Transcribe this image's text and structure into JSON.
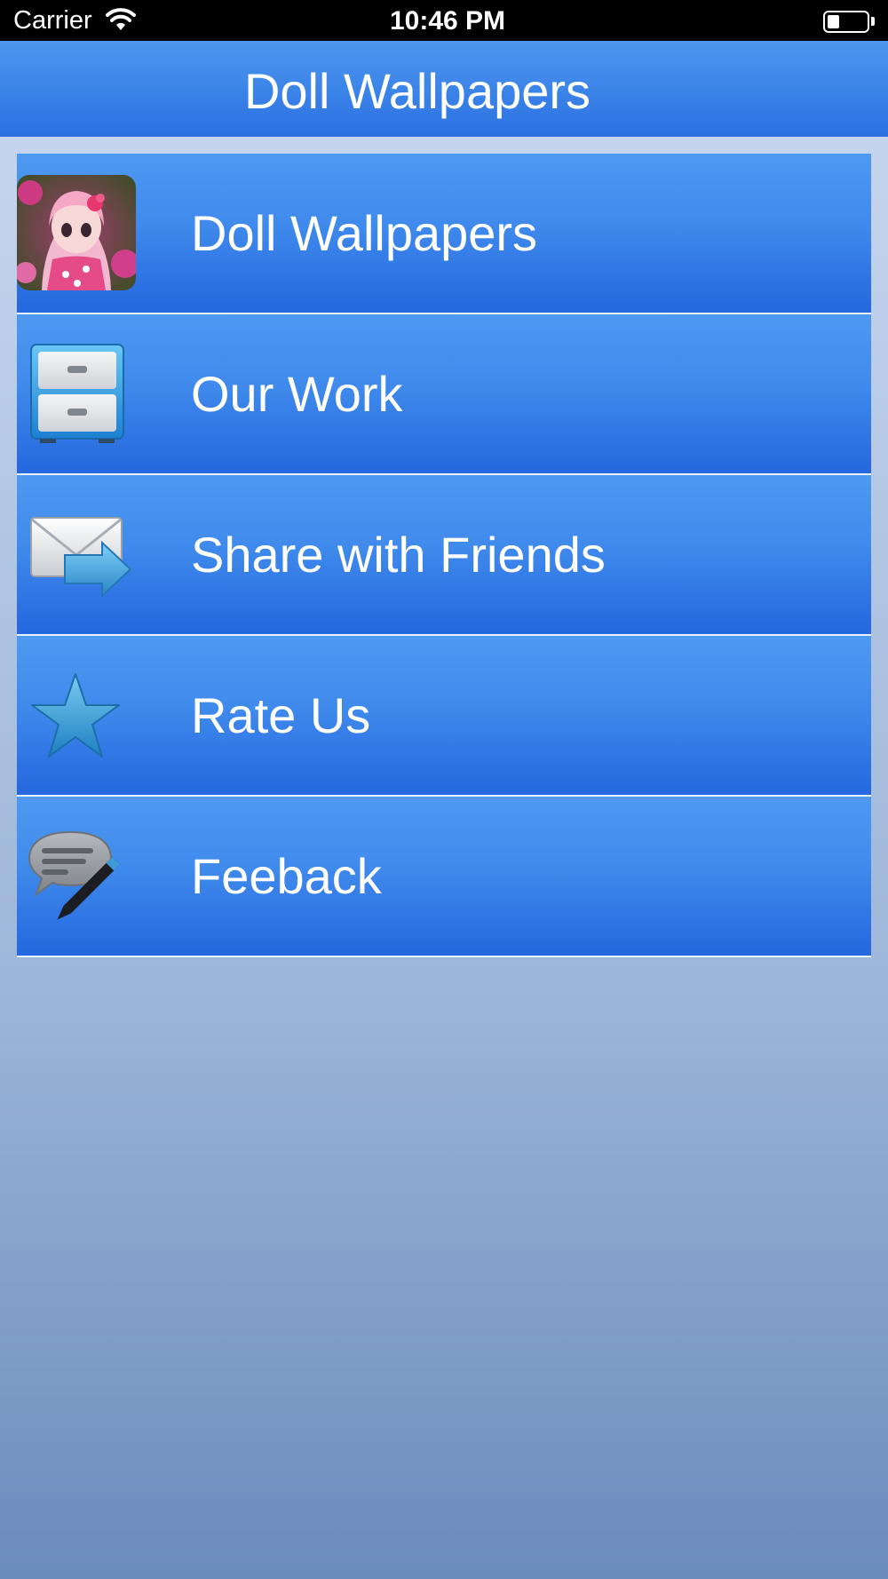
{
  "status_bar": {
    "carrier": "Carrier",
    "time": "10:46 PM",
    "wifi_icon": "wifi-icon",
    "battery_icon": "battery-icon",
    "battery_level": 0.3
  },
  "nav_bar": {
    "title": "Doll Wallpapers"
  },
  "menu": {
    "items": [
      {
        "label": "Doll Wallpapers",
        "icon": "doll-photo-icon"
      },
      {
        "label": "Our Work",
        "icon": "file-cabinet-icon"
      },
      {
        "label": "Share with Friends",
        "icon": "mail-share-icon"
      },
      {
        "label": "Rate Us",
        "icon": "star-icon"
      },
      {
        "label": "Feeback",
        "icon": "speech-bubble-pencil-icon"
      }
    ]
  },
  "colors": {
    "status_bar": "#000000",
    "nav_bar": "#3a83e8",
    "menu_item": "#3f8aec",
    "text": "#ffffff"
  }
}
